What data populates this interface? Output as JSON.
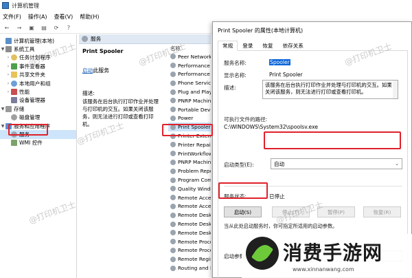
{
  "window": {
    "title": "计算机管理",
    "menu": [
      "文件(F)",
      "操作(A)",
      "查看(V)",
      "帮助(H)"
    ]
  },
  "toolbar": {
    "back": "←",
    "forward": "→",
    "icons": [
      "up-icon",
      "properties-icon",
      "refresh-icon",
      "help-icon"
    ]
  },
  "tree": {
    "items": [
      {
        "label": "计算机管理(本地)",
        "icon": "computer-icon",
        "expander": ""
      },
      {
        "label": "系统工具",
        "icon": "tools-icon",
        "expander": "▼"
      },
      {
        "label": "任务计划程序",
        "icon": "clock-icon",
        "expander": "›"
      },
      {
        "label": "事件查看器",
        "icon": "event-icon",
        "expander": "›"
      },
      {
        "label": "共享文件夹",
        "icon": "folder-icon",
        "expander": "›"
      },
      {
        "label": "本地用户和组",
        "icon": "users-icon",
        "expander": "›"
      },
      {
        "label": "性能",
        "icon": "perf-icon",
        "expander": "›"
      },
      {
        "label": "设备管理器",
        "icon": "device-icon",
        "expander": ""
      },
      {
        "label": "存储",
        "icon": "storage-icon",
        "expander": "▼"
      },
      {
        "label": "磁盘管理",
        "icon": "disk-icon",
        "expander": ""
      },
      {
        "label": "服务和应用程序",
        "icon": "app-icon",
        "expander": "▼"
      },
      {
        "label": "服务",
        "icon": "gear-icon",
        "expander": ""
      },
      {
        "label": "WMI 控件",
        "icon": "wmi-icon",
        "expander": ""
      }
    ]
  },
  "middle": {
    "header": "服务",
    "service_title": "Print Spooler",
    "start_link": "启动",
    "start_link_suffix": "此服务",
    "desc_label": "描述:",
    "desc_text": "该服务在后台执行打印作业并处理与打印机的交互。如果关闭该服务，则无法进行打印或查看打印机。",
    "list_header": "名称",
    "list": [
      "Peer Network",
      "Performance C",
      "Performance C",
      "Phone Service",
      "Plug and Play",
      "PNRP Machine",
      "Portable Devi",
      "Power",
      "Print Spooler",
      "Printer Extensi",
      "Printer Repair",
      "PrintWorkflow",
      "PNRP Machine",
      "Problem Repo",
      "Program Com",
      "Quality Windo",
      "Remote Acces",
      "Remote Acces",
      "Remote Deskt",
      "Remote Deskt",
      "Remote Deskt",
      "Remote Proce",
      "Remote Proce",
      "Remote Regis",
      "Routing and R"
    ]
  },
  "dialog": {
    "title": "Print Spooler 的属性(本地计算机)",
    "tabs": [
      "常规",
      "登录",
      "恢复",
      "依存关系"
    ],
    "service_name_label": "服务名称:",
    "service_name": "Spooler",
    "display_name_label": "显示名称:",
    "display_name": "Print Spooler",
    "desc_label": "描述:",
    "desc": "该服务在后台执行打印作业并处理与打印机的交互。如果关闭该服务，则无法进行打印或查看打印机。",
    "path_label": "可执行文件的路径:",
    "path": "C:\\WINDOWS\\System32\\spoolsv.exe",
    "startup_label": "启动类型(E):",
    "startup_value": "自动",
    "status_label": "服务状态:",
    "status_value": "已停止",
    "buttons": {
      "start": "启动(S)",
      "stop": "停止(T)",
      "pause": "暂停(P)",
      "resume": "恢复(R)"
    },
    "hint": "当从此处启动服务时，你可指定所适用的启动参数。",
    "param_label": "启动参数(M):"
  },
  "watermark": "@打印机卫士",
  "logo": {
    "brand": "消费手游网",
    "url": "www.xinnanwang.com"
  },
  "colors": {
    "selection": "#cde4fa",
    "highlight_red": "#e0202a",
    "accent_blue": "#0a64d8"
  }
}
